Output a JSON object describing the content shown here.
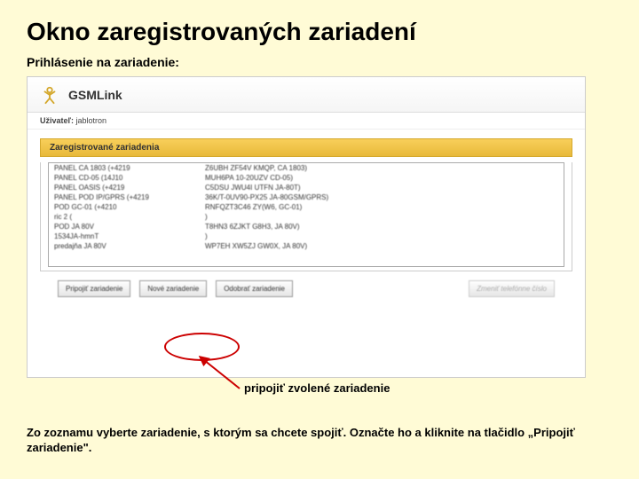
{
  "page": {
    "title": "Okno zaregistrovaných zariadení",
    "subtitle": "Prihlásenie na zariadenie:",
    "callout": "pripojiť zvolené zariadenie",
    "footer": "Zo zoznamu vyberte zariadenie, s ktorým sa chcete spojiť. Označte ho a kliknite na tlačidlo „Pripojiť zariadenie\"."
  },
  "app": {
    "name": "GSMLink",
    "user_label": "Uživateľ:",
    "user_value": "jablotron",
    "panel_title": "Zaregistrované zariadenia"
  },
  "devices": [
    {
      "c1": "PANEL CA 1803 (+4219",
      "c2": "Z6UBH ZF54V KMQP, CA 1803)"
    },
    {
      "c1": "PANEL CD-05 (14J10",
      "c2": "MUH6PA 10-20UZV CD-05)"
    },
    {
      "c1": "PANEL OASIS (+4219",
      "c2": "C5DSU JWU4I UTFN JA-80T)"
    },
    {
      "c1": "PANEL POD IP/GPRS (+4219",
      "c2": "36K/T-0UV90-PX25 JA-80GSM/GPRS)"
    },
    {
      "c1": "POD GC-01 (+4210",
      "c2": "RNFQZT3C46 ZY(W6, GC-01)"
    },
    {
      "c1": "ric 2 (",
      "c2": ")"
    },
    {
      "c1": "POD JA 80V",
      "c2": "T8HN3 6ZJKT G8H3, JA 80V)"
    },
    {
      "c1": "1534JA-hmnT",
      "c2": ")"
    },
    {
      "c1": "predajňa JA 80V",
      "c2": "WP7EH XW5ZJ GW0X, JA 80V)"
    }
  ],
  "buttons": {
    "connect": "Pripojiť zariadenie",
    "new": "Nové zariadenie",
    "delete": "Odobrať zariadenie",
    "share": "Zmeniť telefónne číslo"
  }
}
